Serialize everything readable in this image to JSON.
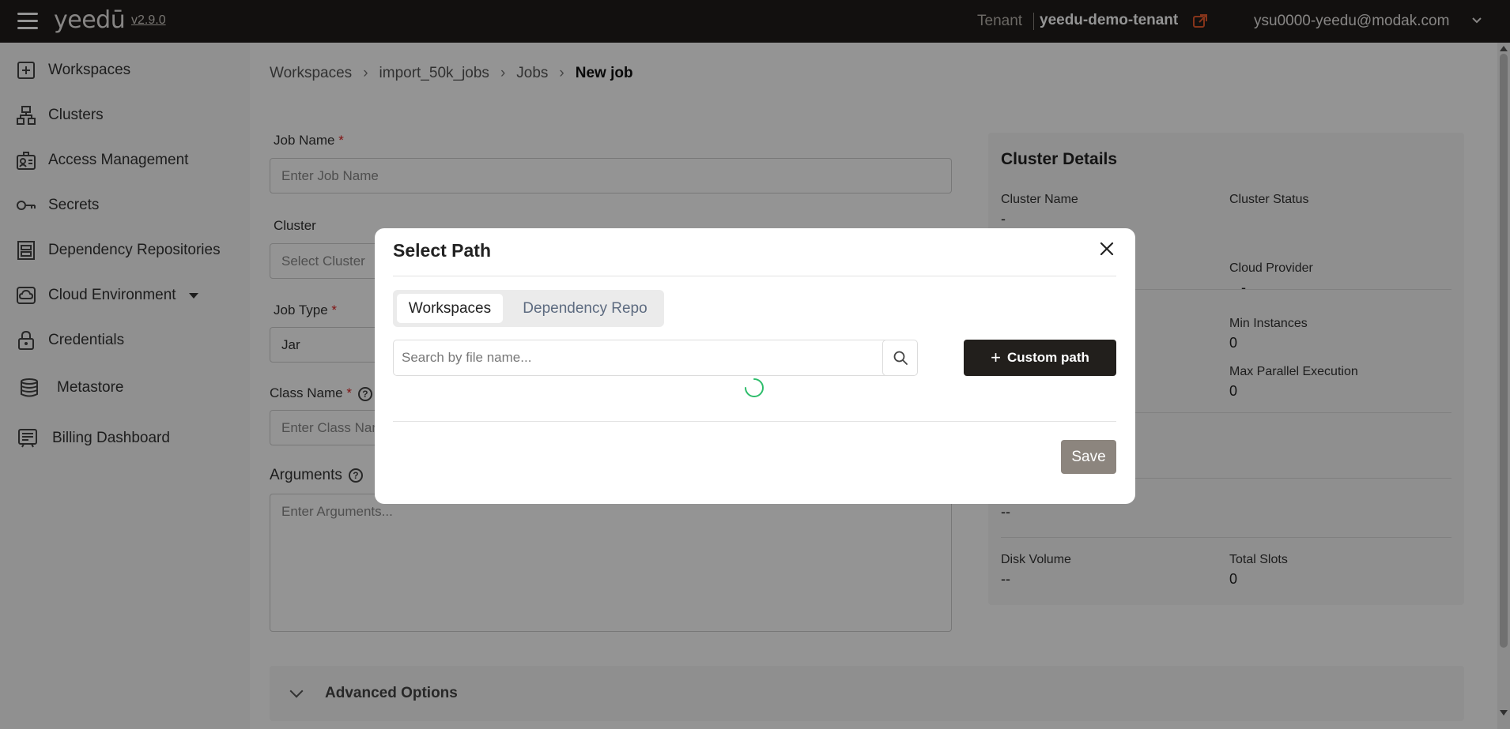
{
  "header": {
    "logo": "yeedū",
    "version": "v2.9.0",
    "tenant_label": "Tenant",
    "tenant_name": "yeedu-demo-tenant",
    "user_email": "ysu0000-yeedu@modak.com"
  },
  "sidebar": {
    "items": [
      {
        "label": "Workspaces",
        "icon": "workspace-icon"
      },
      {
        "label": "Clusters",
        "icon": "cluster-icon"
      },
      {
        "label": "Access Management",
        "icon": "access-management-icon"
      },
      {
        "label": "Secrets",
        "icon": "key-icon"
      },
      {
        "label": "Dependency Repositories",
        "icon": "repository-icon"
      },
      {
        "label": "Cloud Environment",
        "icon": "cloud-icon"
      },
      {
        "label": "Credentials",
        "icon": "lock-icon"
      },
      {
        "label": "Metastore",
        "icon": "database-icon"
      },
      {
        "label": "Billing Dashboard",
        "icon": "billing-icon"
      }
    ]
  },
  "breadcrumb": [
    "Workspaces",
    "import_50k_jobs",
    "Jobs",
    "New job"
  ],
  "form": {
    "job_name_label": "Job Name",
    "job_name_placeholder": "Enter Job Name",
    "cluster_label": "Cluster",
    "cluster_placeholder": "Select Cluster",
    "job_type_label": "Job Type",
    "job_type_value": "Jar",
    "class_name_label": "Class Name",
    "class_name_placeholder": "Enter Class Name",
    "arguments_label": "Arguments",
    "arguments_placeholder": "Enter Arguments...",
    "required_mark": "*",
    "help_glyph": "?"
  },
  "cluster_details": {
    "title": "Cluster Details",
    "cluster_name_label": "Cluster Name",
    "cluster_name_value": "-",
    "cluster_status_label": "Cluster Status",
    "cloud_provider_label": "Cloud Provider",
    "cloud_provider_value": "-",
    "min_instances_label": "Min Instances",
    "min_instances_value": "0",
    "max_parallel_label": "Max Parallel Execution",
    "max_parallel_value": "0",
    "hidden_value": "--",
    "disk_volume_label": "Disk Volume",
    "disk_volume_value": "--",
    "total_slots_label": "Total Slots",
    "total_slots_value": "0"
  },
  "advanced_options_label": "Advanced Options",
  "modal": {
    "title": "Select Path",
    "tabs": [
      "Workspaces",
      "Dependency Repo"
    ],
    "active_tab": "Workspaces",
    "search_placeholder": "Search by file name...",
    "custom_path_label": "Custom path",
    "save_label": "Save"
  },
  "colors": {
    "topbar": "#1f1d1b",
    "accent_orange": "#e55b2e",
    "spinner_green": "#2ebd6b",
    "save_button": "#8c857e"
  }
}
